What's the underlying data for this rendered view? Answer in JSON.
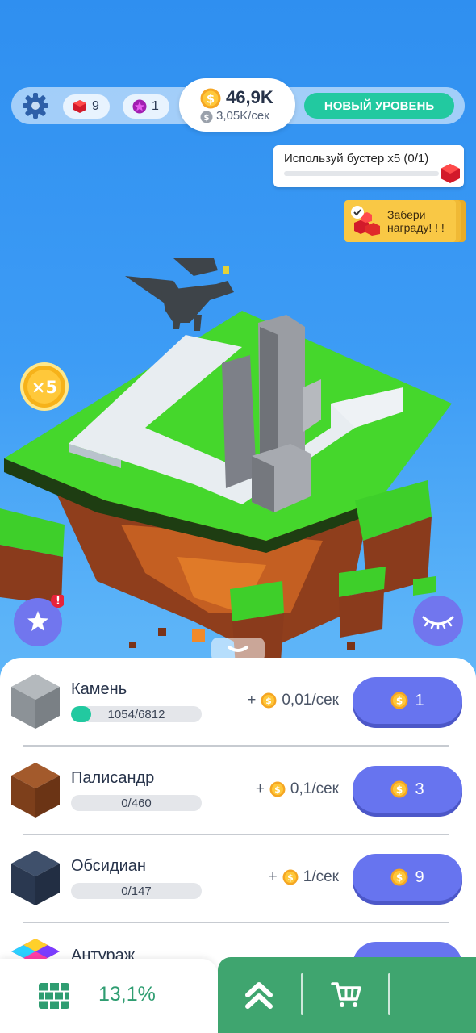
{
  "hud": {
    "gems": "9",
    "stars": "1",
    "money": "46,9K",
    "rate": "3,05K/сек",
    "new_level": "НОВЫЙ УРОВЕНЬ"
  },
  "quest": {
    "text": "Используй бустер x5 (0/1)",
    "progress": 0
  },
  "reward": {
    "text": "Забери награду!",
    "marks": "! !"
  },
  "booster": {
    "label": "×5"
  },
  "blocks": [
    {
      "name": "Камень",
      "progress_text": "1054/6812",
      "progress": 0.155,
      "income": "0,01/сек",
      "price": "1",
      "color": "#9aa0a4"
    },
    {
      "name": "Палисандр",
      "progress_text": "0/460",
      "progress": 0,
      "income": "0,1/сек",
      "price": "3",
      "color": "#8b4a24"
    },
    {
      "name": "Обсидиан",
      "progress_text": "0/147",
      "progress": 0,
      "income": "1/сек",
      "price": "9",
      "color": "#2f3d55"
    },
    {
      "name": "Антураж"
    }
  ],
  "income_prefix": "+",
  "footer": {
    "percent": "13,1%"
  },
  "colors": {
    "accent": "#22c9a0",
    "buy": "#6774ef",
    "footer_green": "#3fa56f"
  }
}
